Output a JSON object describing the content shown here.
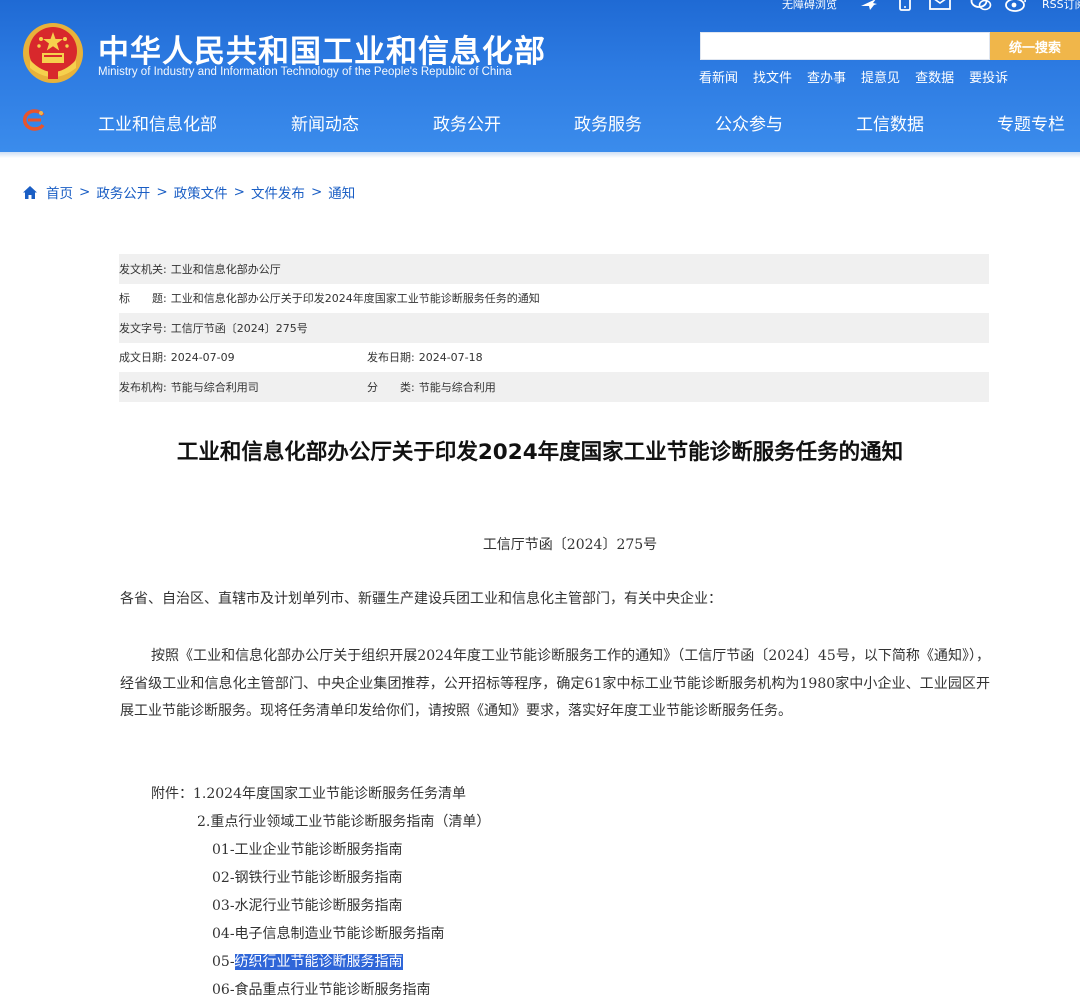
{
  "header": {
    "site_title": "中华人民共和国工业和信息化部",
    "site_subtitle": "Ministry of Industry and Information Technology of the People's Republic of China",
    "accessible_label": "无障碍浏览",
    "rss_label": "RSS订阅",
    "search": {
      "value": "",
      "placeholder": "",
      "button_label": "统一搜索"
    },
    "quick_links": [
      "看新闻",
      "找文件",
      "查办事",
      "提意见",
      "查数据",
      "要投诉"
    ],
    "nav": [
      "工业和信息化部",
      "新闻动态",
      "政务公开",
      "政务服务",
      "公众参与",
      "工信数据",
      "专题专栏"
    ]
  },
  "breadcrumb": [
    "首页",
    "政务公开",
    "政策文件",
    "文件发布",
    "通知"
  ],
  "meta": {
    "issuer_label": "发文机关:",
    "issuer": "工业和信息化部办公厅",
    "title_label": "标　　题:",
    "title": "工业和信息化部办公厅关于印发2024年度国家工业节能诊断服务任务的通知",
    "docno_label": "发文字号:",
    "docno": "工信厅节函〔2024〕275号",
    "created_label": "成文日期:",
    "created": "2024-07-09",
    "published_label": "发布日期:",
    "published": "2024-07-18",
    "org_label": "发布机构:",
    "org": "节能与综合利用司",
    "category_label": "分　　类:",
    "category": "节能与综合利用"
  },
  "article": {
    "title": "工业和信息化部办公厅关于印发2024年度国家工业节能诊断服务任务的通知",
    "doc_number": "工信厅节函〔2024〕275号",
    "salutation": "各省、自治区、直辖市及计划单列市、新疆生产建设兵团工业和信息化主管部门，有关中央企业：",
    "paragraph": "按照《工业和信息化部办公厅关于组织开展2024年度工业节能诊断服务工作的通知》（工信厅节函〔2024〕45号，以下简称《通知》），经省级工业和信息化主管部门、中央企业集团推荐，公开招标等程序，确定61家中标工业节能诊断服务机构为1980家中小企业、工业园区开展工业节能诊断服务。现将任务清单印发给你们，请按照《通知》要求，落实好年度工业节能诊断服务任务。",
    "attachments_label": "附件：",
    "attachment_1": "1.2024年度国家工业节能诊断服务任务清单",
    "attachment_2": "2.重点行业领域工业节能诊断服务指南（清单）",
    "guides": [
      "01-工业企业节能诊断服务指南",
      "02-钢铁行业节能诊断服务指南",
      "03-水泥行业节能诊断服务指南",
      "04-电子信息制造业节能诊断服务指南",
      "纺织行业节能诊断服务指南",
      "06-食品重点行业节能诊断服务指南"
    ],
    "guide_05_prefix": "05-"
  },
  "colors": {
    "header_blue": "#2d7be2",
    "search_button": "#f0b64a",
    "link_blue": "#1a5ec4",
    "highlight": "#2f66d8"
  }
}
